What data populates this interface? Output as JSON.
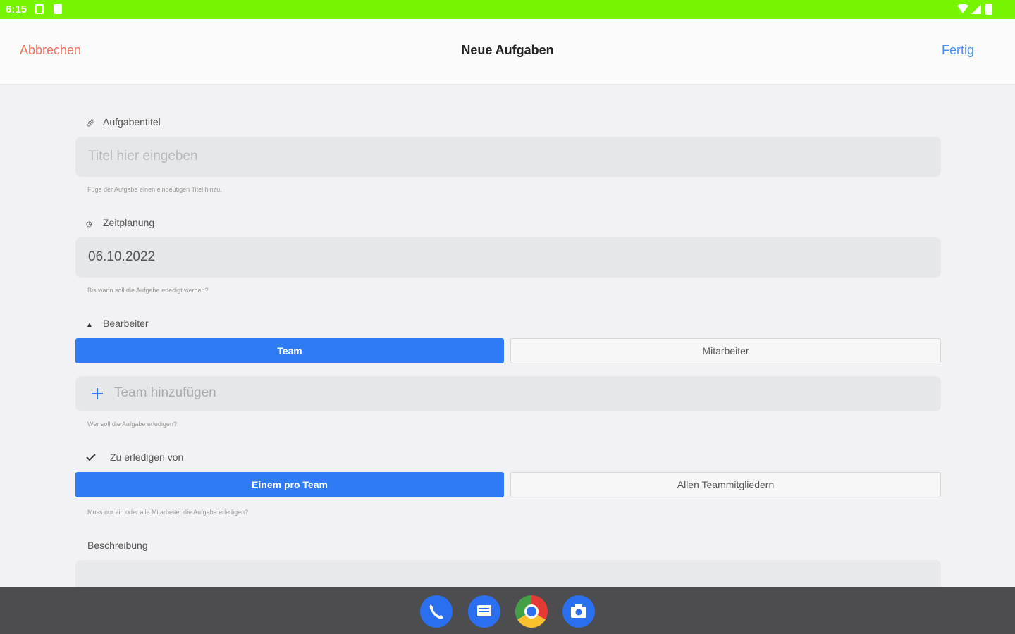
{
  "status_bar": {
    "time": "6:15"
  },
  "header": {
    "cancel_label": "Abbrechen",
    "title": "Neue Aufgaben",
    "done_label": "Fertig"
  },
  "task_title": {
    "label": "Aufgabentitel",
    "placeholder": "Titel hier eingeben",
    "hint": "Füge der Aufgabe einen eindeutigen Titel hinzu."
  },
  "schedule": {
    "label": "Zeitplanung",
    "value": "06.10.2022",
    "hint": "Bis wann soll die Aufgabe erledigt werden?"
  },
  "assignee": {
    "label": "Bearbeiter",
    "options": [
      "Team",
      "Mitarbeiter"
    ],
    "selected": "Team",
    "add_label": "Team hinzufügen",
    "hint": "Wer soll die Aufgabe erledigen?"
  },
  "completion": {
    "label": "Zu erledigen von",
    "options": [
      "Einem pro Team",
      "Allen Teammitgliedern"
    ],
    "selected": "Einem pro Team",
    "hint": "Muss nur ein oder alle Mitarbeiter die Aufgabe erledigen?"
  },
  "description": {
    "label": "Beschreibung"
  },
  "dock": {
    "apps": [
      "phone-icon",
      "messages-icon",
      "chrome-icon",
      "camera-icon"
    ]
  },
  "colors": {
    "status_bar": "#76f400",
    "cancel": "#f2705c",
    "done": "#4a8ef7",
    "segment_active": "#2f7bf5",
    "field_bg": "#e6e7e9"
  }
}
